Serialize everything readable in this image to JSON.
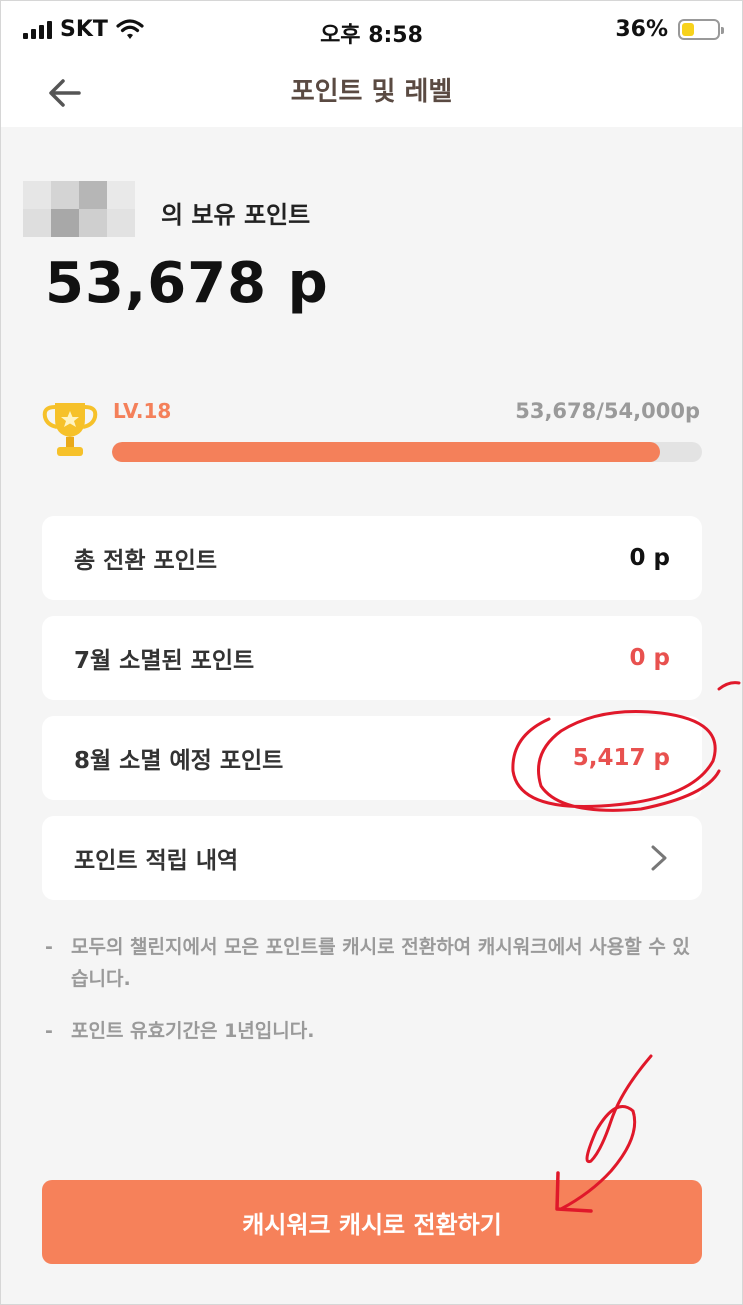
{
  "status_bar": {
    "carrier": "SKT",
    "time": "오후 8:58",
    "battery_text": "36%",
    "battery_level": 0.36,
    "icons": [
      "signal-icon",
      "wifi-icon",
      "battery-icon"
    ]
  },
  "nav": {
    "title": "포인트 및 레벨",
    "back_icon": "back-arrow-icon"
  },
  "owner": {
    "suffix": "의 보유 포인트"
  },
  "points": {
    "total": "53,678 p"
  },
  "level": {
    "label": "LV.18",
    "progress_text": "53,678/54,000p",
    "progress_fraction": 0.994,
    "icon": "trophy-icon"
  },
  "cards": [
    {
      "label": "총 전환 포인트",
      "value": "0 p"
    },
    {
      "label": "7월 소멸된 포인트",
      "value": "0 p"
    },
    {
      "label": "8월 소멸 예정 포인트",
      "value": "5,417 p"
    },
    {
      "label": "포인트 적립 내역"
    }
  ],
  "notes": [
    {
      "dash": "-",
      "text": "모두의 챌린지에서 모은 포인트를 캐시로 전환하여 캐시워크에서 사용할 수 있습니다."
    },
    {
      "dash": "-",
      "text": "포인트 유효기간은 1년입니다."
    }
  ],
  "cta": {
    "label": "캐시워크 캐시로 전환하기"
  },
  "colors": {
    "accent": "#f4805a",
    "expiry_red": "#e8514f",
    "annotation_red": "#e0182a"
  }
}
